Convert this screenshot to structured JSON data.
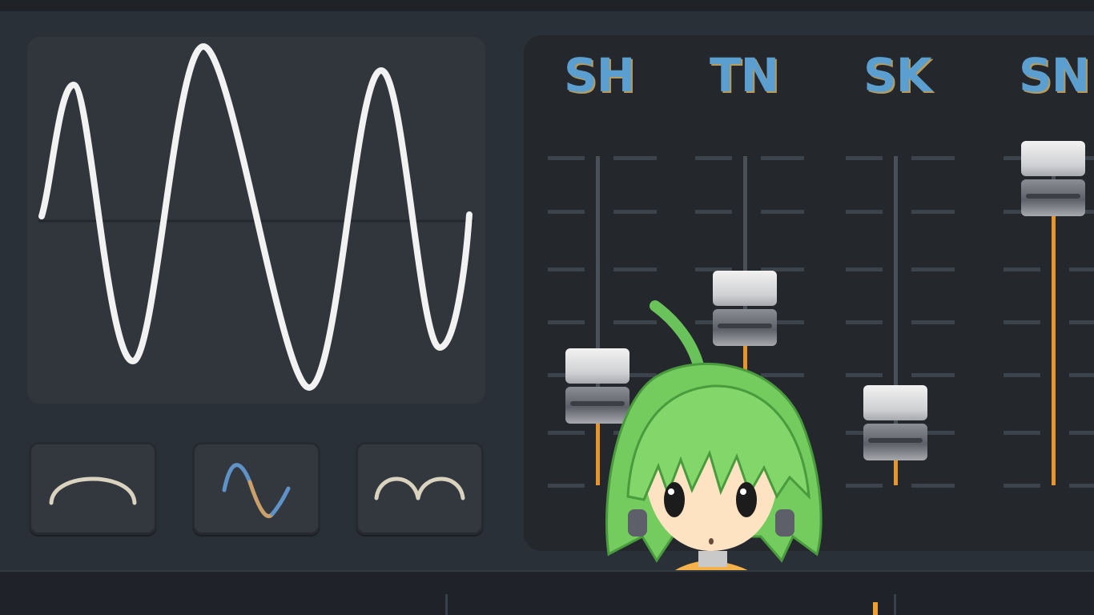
{
  "channels": [
    {
      "label": "SH",
      "level": 0.2
    },
    {
      "label": "TN",
      "level": 0.5
    },
    {
      "label": "SK",
      "level": 0.06
    },
    {
      "label": "SN",
      "level": 1.0
    }
  ],
  "wave_buttons": [
    {
      "icon": "arch-wave-icon"
    },
    {
      "icon": "sine-wave-icon"
    },
    {
      "icon": "double-arch-wave-icon"
    }
  ],
  "colors": {
    "accent": "#e8962a",
    "label": "#5a9fd0",
    "waveform": "#f2f2f2"
  },
  "mascot": {
    "icon": "green-haired-mascot-icon"
  }
}
